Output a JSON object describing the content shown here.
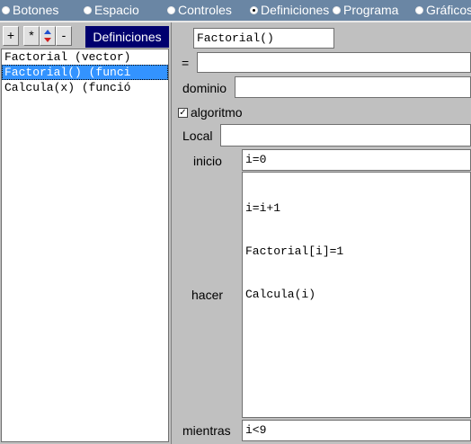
{
  "tabs": [
    {
      "label": "Botones",
      "selected": false
    },
    {
      "label": "Espacio",
      "selected": false
    },
    {
      "label": "Controles",
      "selected": false
    },
    {
      "label": "Definiciones",
      "selected": true
    },
    {
      "label": "Programa",
      "selected": false
    },
    {
      "label": "Gráficos",
      "selected": false
    }
  ],
  "toolbar": {
    "add_label": "+",
    "star_label": "*",
    "up_icon": "arrow-up-icon",
    "down_icon": "arrow-down-icon",
    "remove_label": "-"
  },
  "definitions": {
    "header": "Definiciones",
    "items": [
      {
        "text": "Factorial (vector)",
        "selected": false
      },
      {
        "text": "Factorial() (funci",
        "selected": true
      },
      {
        "text": "Calcula(x) (funció",
        "selected": false
      }
    ]
  },
  "editor": {
    "name_value": "Factorial()",
    "equals_label": "=",
    "equals_value": "",
    "domain_label": "dominio",
    "domain_value": "",
    "algorithm_label": "algoritmo",
    "algorithm_checked": true,
    "local_label": "Local",
    "local_value": "",
    "init_label": "inicio",
    "init_value": "i=0",
    "do_label": "hacer",
    "do_lines": [
      "i=i+1",
      "Factorial[i]=1",
      "Calcula(i)"
    ],
    "while_label": "mientras",
    "while_value": "i<9"
  },
  "colors": {
    "tabbar": "#6a86a4",
    "panel": "#c0c0c0",
    "header": "#00006e",
    "selection": "#3393ff"
  }
}
